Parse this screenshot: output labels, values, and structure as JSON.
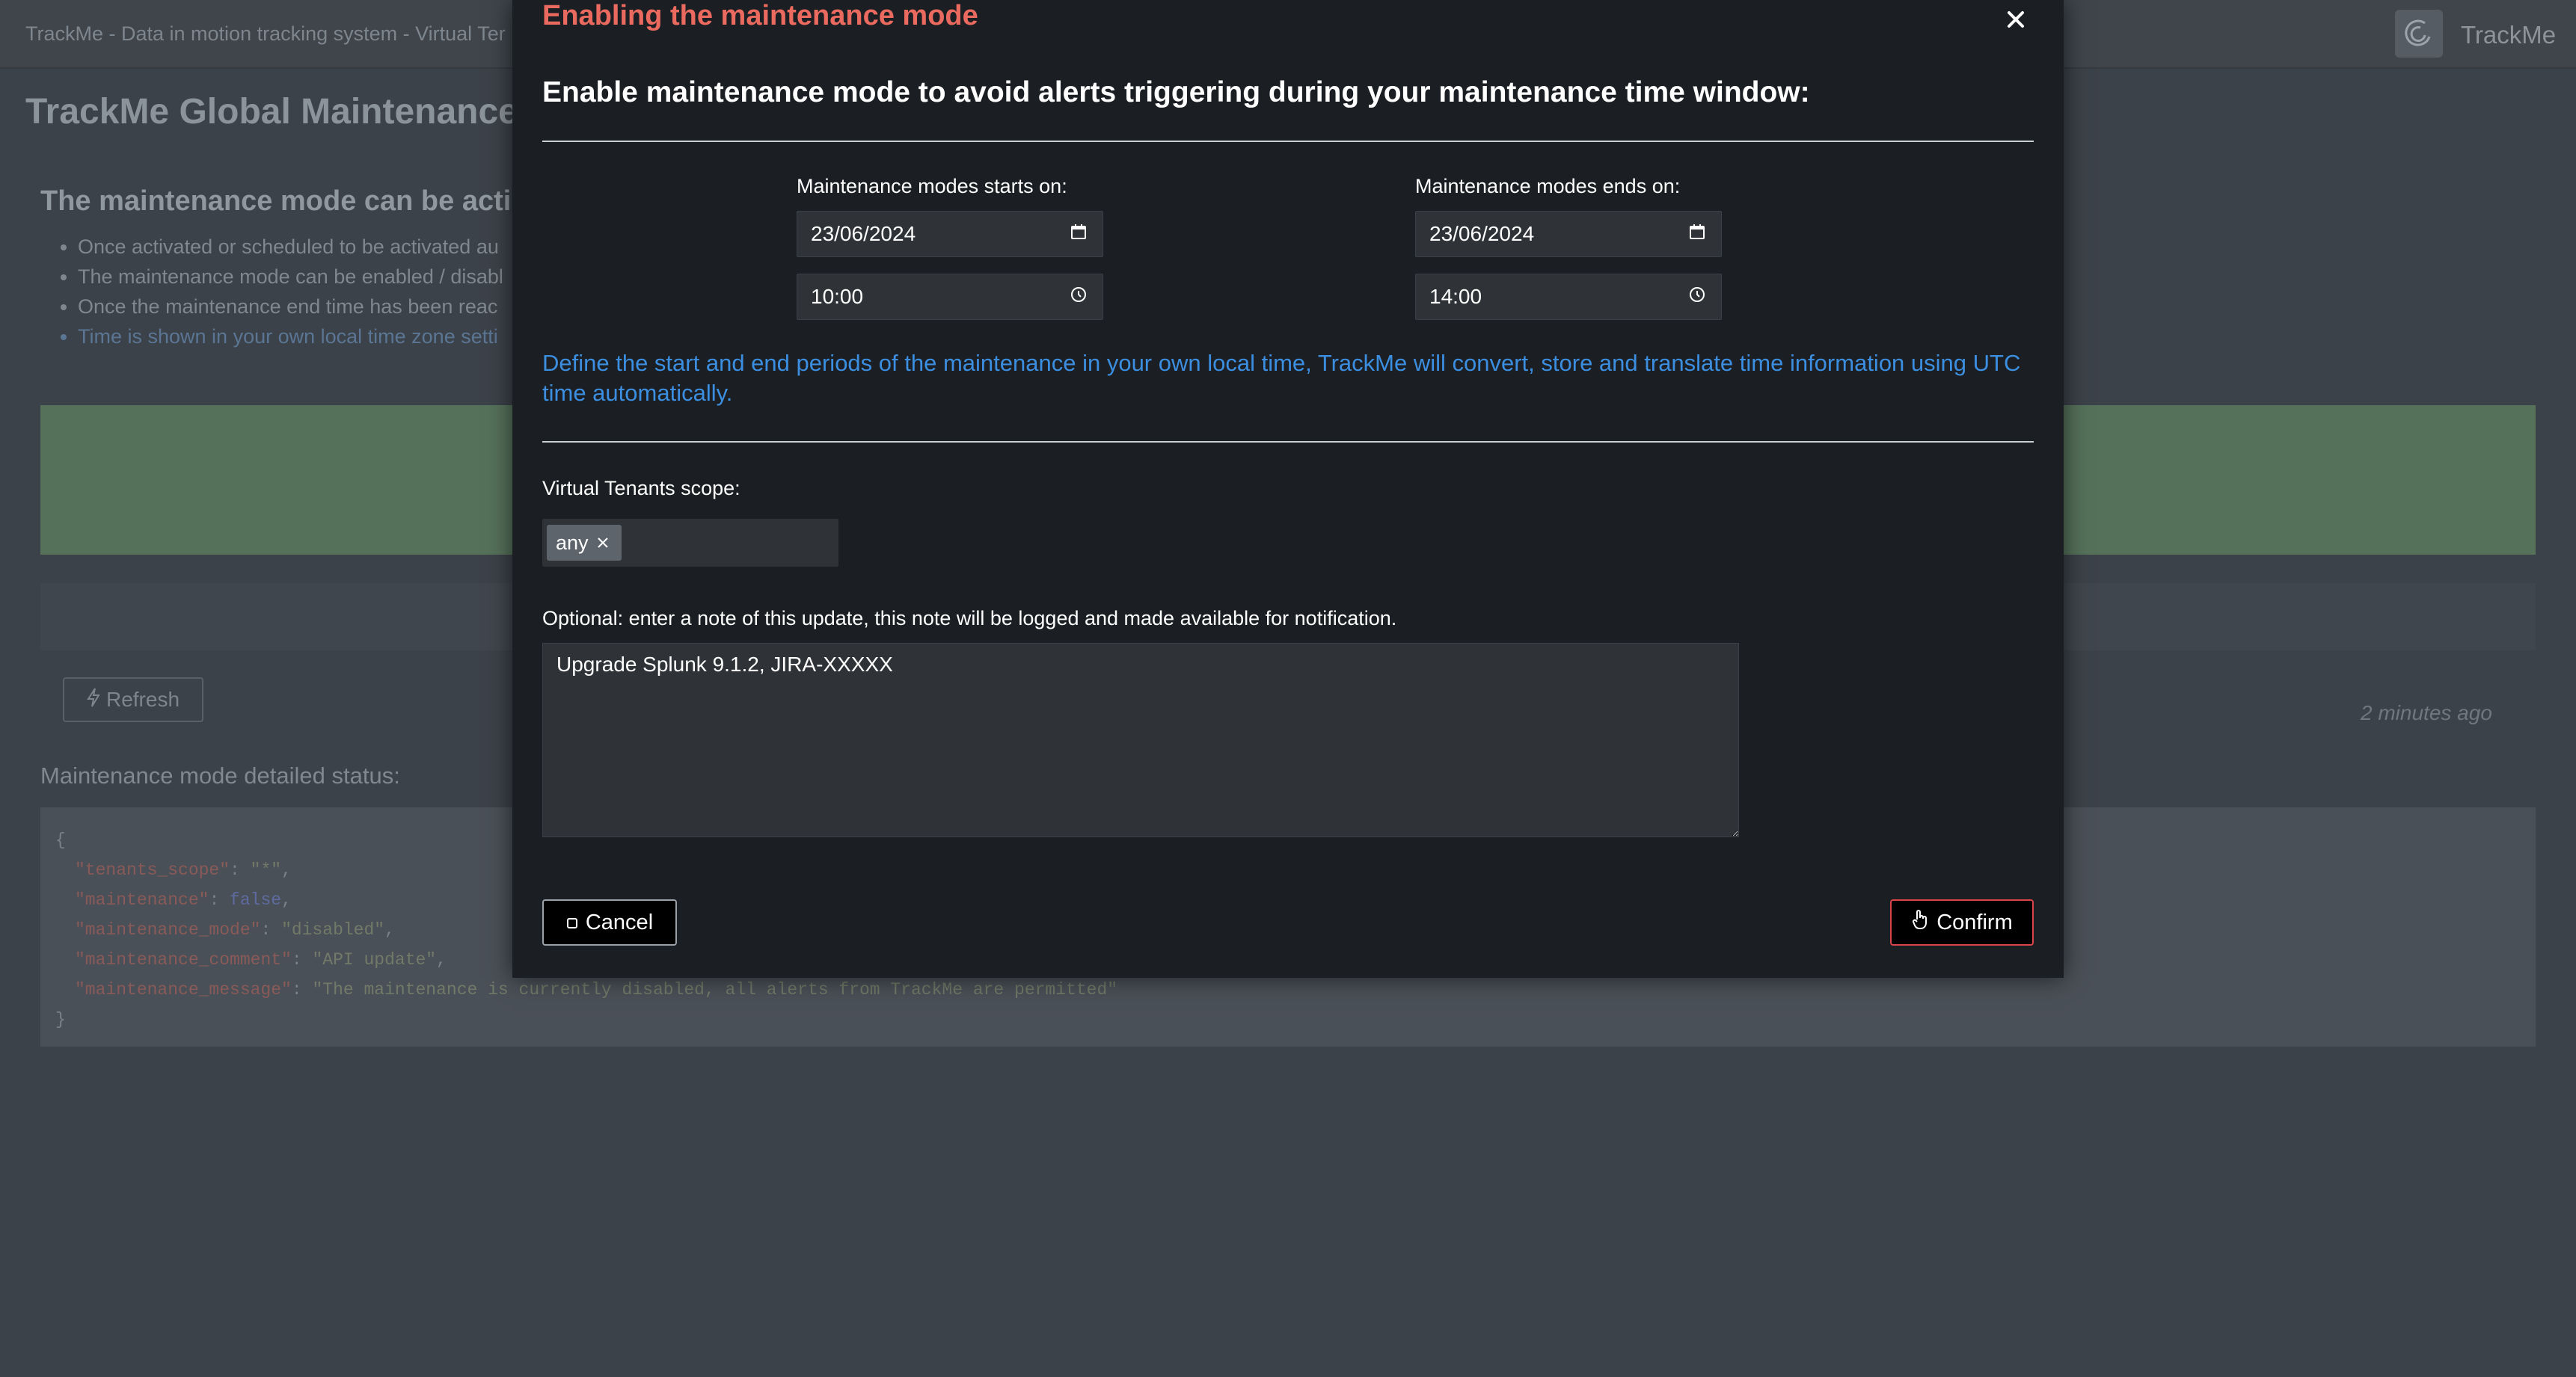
{
  "background": {
    "topbar_title": "TrackMe - Data in motion tracking system - Virtual Ter",
    "logo_text": "TrackMe",
    "page_title": "TrackMe Global Maintenance M",
    "subtitle": "The maintenance mode can be acti",
    "bullets": [
      "Once activated or scheduled to be activated au",
      "The maintenance mode can be enabled / disabl",
      "Once the maintenance end time has been reac",
      "Time is shown in your own local time zone setti"
    ],
    "refresh_label": "Refresh",
    "updated_ago": "2 minutes ago",
    "detailed_status_label": "Maintenance mode detailed status:",
    "json_lines": {
      "open": "{",
      "close": "}",
      "tenants_scope_key": "\"tenants_scope\"",
      "tenants_scope_val": "\"*\"",
      "maintenance_key": "\"maintenance\"",
      "maintenance_val": "false",
      "maintenance_mode_key": "\"maintenance_mode\"",
      "maintenance_mode_val": "\"disabled\"",
      "maintenance_comment_key": "\"maintenance_comment\"",
      "maintenance_comment_val": "\"API update\"",
      "maintenance_message_key": "\"maintenance_message\"",
      "maintenance_message_val": "\"The maintenance is currently disabled, all alerts from TrackMe are permitted\""
    }
  },
  "modal": {
    "title": "Enabling the maintenance mode",
    "heading": "Enable maintenance mode to avoid alerts triggering during your maintenance time window:",
    "start_label": "Maintenance modes starts on:",
    "end_label": "Maintenance modes ends on:",
    "start_date": "23/06/2024",
    "start_time": "10:00",
    "end_date": "23/06/2024",
    "end_time": "14:00",
    "info_text": "Define the start and end periods of the maintenance in your own local time, TrackMe will convert, store and translate time information using UTC time automatically.",
    "tenants_label": "Virtual Tenants scope:",
    "tenant_tag": "any",
    "note_label": "Optional: enter a note of this update, this note will be logged and made available for notification.",
    "note_value": "Upgrade Splunk 9.1.2, JIRA-XXXXX",
    "cancel_label": "Cancel",
    "confirm_label": "Confirm"
  },
  "colors": {
    "modal_title": "#ea6a5f",
    "info_link": "#3c8ee0",
    "confirm_border": "#d9464a"
  },
  "icons": [
    "close-icon",
    "calendar-icon",
    "clock-icon",
    "remove-tag-icon",
    "stop-icon",
    "hand-pointer-icon",
    "bolt-icon",
    "trackme-logo-icon"
  ]
}
